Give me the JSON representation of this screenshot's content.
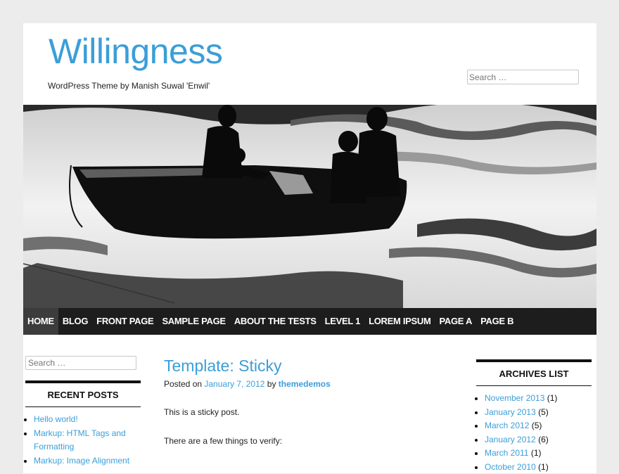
{
  "site": {
    "title": "Willingness",
    "description": "WordPress Theme by Manish Suwal 'Enwil'"
  },
  "header_search": {
    "placeholder": "Search …"
  },
  "nav": {
    "items": [
      "HOME",
      "BLOG",
      "FRONT PAGE",
      "SAMPLE PAGE",
      "ABOUT THE TESTS",
      "LEVEL 1",
      "LOREM IPSUM",
      "PAGE A",
      "PAGE B"
    ]
  },
  "sidebar_left": {
    "search_placeholder": "Search …",
    "recent_posts": {
      "heading": "RECENT POSTS",
      "items": [
        "Hello world!",
        "Markup: HTML Tags and Formatting",
        "Markup: Image Alignment"
      ]
    }
  },
  "post": {
    "title": "Template: Sticky",
    "meta_prefix": "Posted on ",
    "date": "January 7, 2012",
    "meta_by": " by ",
    "author": "themedemos",
    "paragraphs": [
      "This is a sticky post.",
      "There are a few things to verify:"
    ]
  },
  "sidebar_right": {
    "archives": {
      "heading": "ARCHIVES LIST",
      "items": [
        {
          "month": "November 2013",
          "count": " (1)"
        },
        {
          "month": "January 2013",
          "count": " (5)"
        },
        {
          "month": "March 2012",
          "count": " (5)"
        },
        {
          "month": "January 2012",
          "count": " (6)"
        },
        {
          "month": "March 2011",
          "count": " (1)"
        },
        {
          "month": "October 2010",
          "count": " (1)"
        }
      ]
    }
  },
  "colors": {
    "accent": "#3b9ed8",
    "nav_bg": "#1d1d1d",
    "page_bg": "#ececec"
  }
}
